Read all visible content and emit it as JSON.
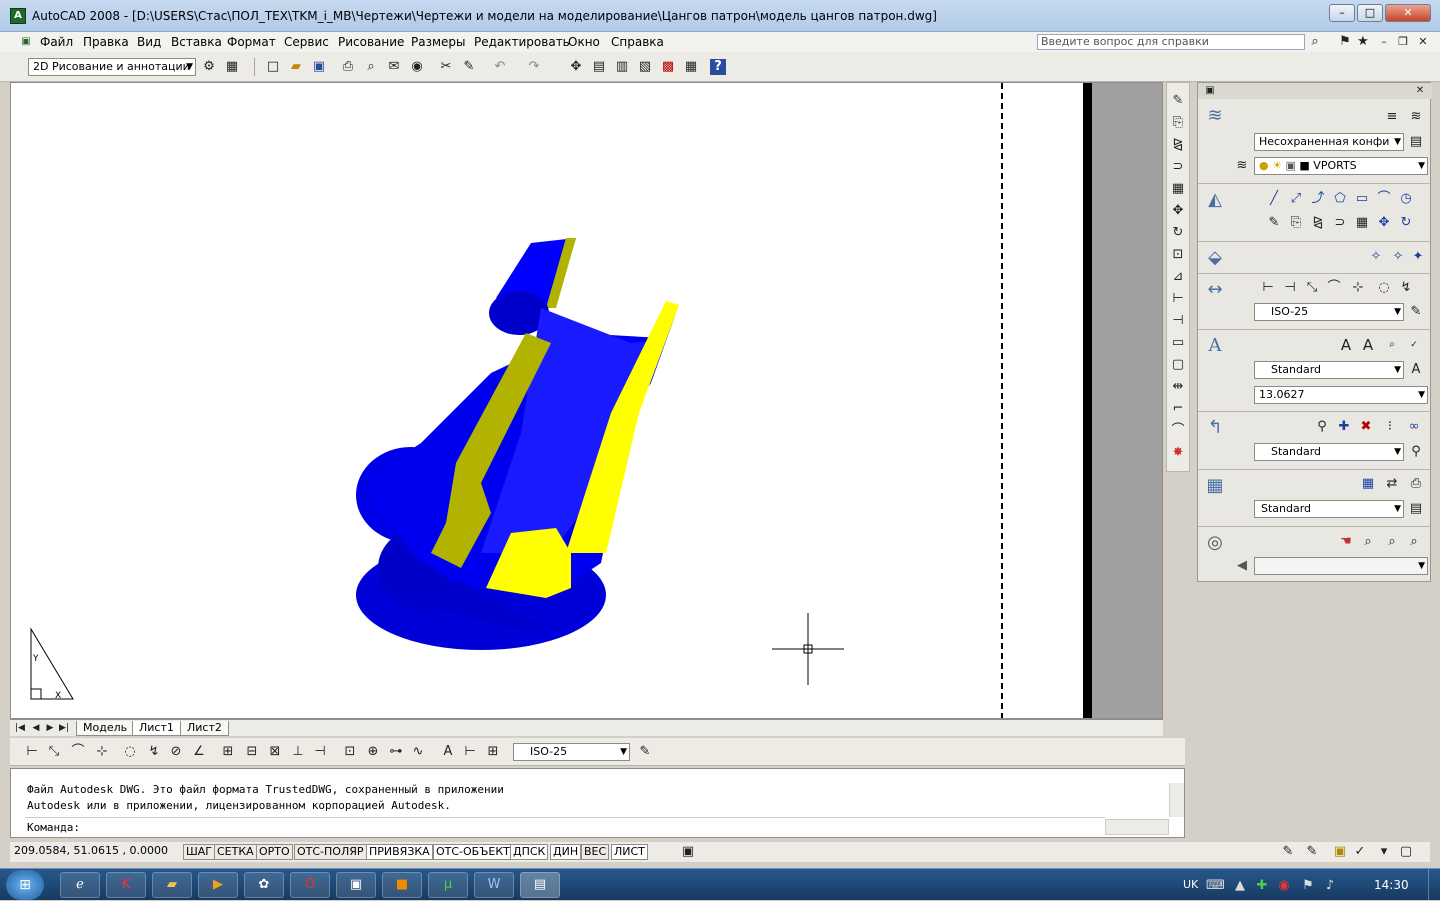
{
  "window": {
    "title": "AutoCAD 2008 - [D:\\USERS\\Стас\\ПОЛ_ТЕХ\\TKM_i_MB\\Чертежи\\Чертежи и модели на моделирование\\Цангов патрон\\модель цангов патрон.dwg]",
    "app_icon": "A",
    "minimize": "–",
    "maximize": "□",
    "close": "✕"
  },
  "menu": {
    "items": [
      "Файл",
      "Правка",
      "Вид",
      "Вставка",
      "Формат",
      "Сервис",
      "Рисование",
      "Размеры",
      "Редактировать",
      "Окно",
      "Справка"
    ],
    "help_placeholder": "Введите вопрос для справки"
  },
  "toolbar": {
    "workspace": "2D Рисование и аннотации"
  },
  "layout_tabs": [
    "Модель",
    "Лист1",
    "Лист2"
  ],
  "dim_toolbar": {
    "dimstyle": "ISO-25"
  },
  "command": {
    "line1": "Файл Autodesk DWG. Это файл формата TrustedDWG, сохраненный в приложении",
    "line2": "Autodesk или в приложении, лицензированном корпорацией Autodesk.",
    "prompt": "Команда:"
  },
  "status": {
    "coords": "209.0584, 51.0615 , 0.0000",
    "toggles": [
      "ШАГ",
      "СЕТКА",
      "ОРТО",
      "ОТС-ПОЛЯР",
      "ПРИВЯЗКА",
      "ОТС-ОБЪЕКТ",
      "ДПСК",
      "ДИН",
      "ВЕС",
      "ЛИСТ"
    ]
  },
  "palette": {
    "layer_state": "Несохраненная конфи",
    "layer_name": "VPORTS",
    "dimstyle": "ISO-25",
    "textstyle": "Standard",
    "text_height": "13.0627",
    "mleaderstyle": "Standard",
    "tablestyle": "Standard"
  },
  "ucs": {
    "y_label": "Y",
    "x_label": "X"
  },
  "taskbar": {
    "lang": "UK",
    "time": "14:30"
  },
  "colors": {
    "model_blue": "#0000ff",
    "model_yellow": "#ffff00",
    "model_olive": "#b2b200",
    "paper_gray": "#a0a0a0"
  }
}
